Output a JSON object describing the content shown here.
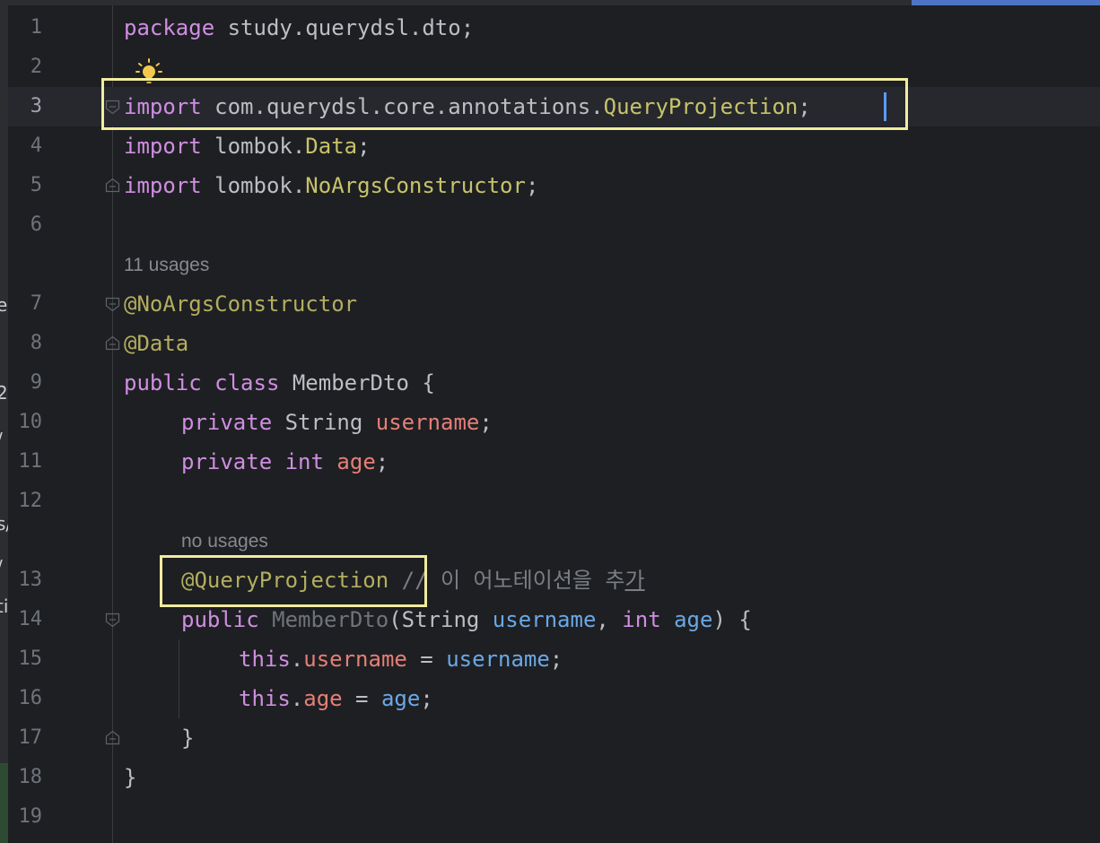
{
  "editor": {
    "file_package": "study.querydsl.dto",
    "colors": {
      "background": "#1e1f22",
      "keyword": "#cf8ee2",
      "annotation": "#b3ae60",
      "class_ref": "#c7c36a",
      "field": "#e57f78",
      "parameter": "#6aa8e6",
      "comment": "#7a7e85",
      "highlight_box": "#f1ec9e"
    },
    "line_numbers": [
      "1",
      "2",
      "3",
      "4",
      "5",
      "6",
      "7",
      "8",
      "9",
      "10",
      "11",
      "12",
      "13",
      "14",
      "15",
      "16",
      "17",
      "18",
      "19"
    ],
    "current_line": "3",
    "inlay_hints": {
      "class_usages": "11 usages",
      "constructor_usages": "no usages"
    },
    "tokens": {
      "kw_package": "package",
      "pkg_name": " study.querydsl.dto;",
      "kw_import": "import",
      "import1_path": " com.querydsl.core.annotations.",
      "import1_class": "QueryProjection",
      "import2_path": " lombok.",
      "import2_class": "Data",
      "import3_class": "NoArgsConstructor",
      "semi": ";",
      "ann_noargs": "@NoArgsConstructor",
      "ann_data": "@Data",
      "kw_public": "public",
      "kw_class": " class",
      "class_name": " MemberDto {",
      "kw_private": "private",
      "type_string": " String ",
      "field_username": "username",
      "kw_int": "int",
      "field_age": "age",
      "ann_qp": "@QueryProjection",
      "comment_prefix": " // 이 어노테이션을 추",
      "comment_last": "가",
      "ctor_name": " MemberDto",
      "ctor_open": "(String ",
      "param_username": "username",
      "comma": ", ",
      "param_age": "age",
      "ctor_close": ") {",
      "kw_this": "this",
      "dot": ".",
      "assign": " = ",
      "close_brace": "}"
    },
    "edge_fragments": [
      "e",
      "2(",
      "/",
      "s/",
      "/",
      "ti"
    ]
  }
}
